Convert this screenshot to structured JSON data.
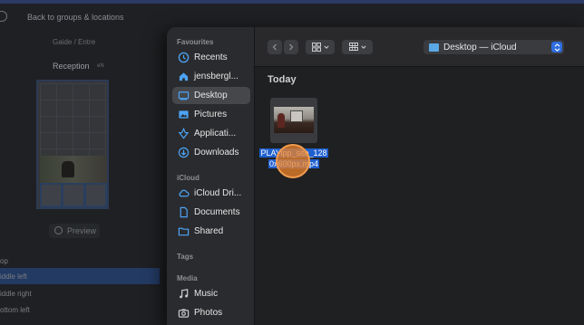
{
  "background_app": {
    "back_link": "Back to groups & locations",
    "tabs_text": "Gaide / Entre",
    "section_title": "Reception",
    "section_badge": "eN",
    "preview_button": "Preview",
    "list_items": [
      "op",
      "iddle left",
      "iddle right",
      "ottom left"
    ]
  },
  "sidebar": {
    "favourites_heading": "Favourites",
    "favourites": [
      {
        "label": "Recents",
        "icon": "clock-icon"
      },
      {
        "label": "jensbergl...",
        "icon": "home-icon"
      },
      {
        "label": "Desktop",
        "icon": "desktop-icon",
        "selected": true
      },
      {
        "label": "Pictures",
        "icon": "photo-icon"
      },
      {
        "label": "Applicati...",
        "icon": "applications-icon"
      },
      {
        "label": "Downloads",
        "icon": "download-icon"
      }
    ],
    "icloud_heading": "iCloud",
    "icloud": [
      {
        "label": "iCloud Dri...",
        "icon": "cloud-icon"
      },
      {
        "label": "Documents",
        "icon": "document-icon"
      },
      {
        "label": "Shared",
        "icon": "shared-folder-icon"
      }
    ],
    "tags_heading": "Tags",
    "media_heading": "Media",
    "media": [
      {
        "label": "Music",
        "icon": "music-note-icon"
      },
      {
        "label": "Photos",
        "icon": "camera-icon"
      }
    ]
  },
  "toolbar": {
    "location_label": "Desktop — iCloud"
  },
  "content": {
    "group_header": "Today",
    "file": {
      "name_line1": "PLAYipp_site_128",
      "name_line2": "0x600px.mp4"
    }
  },
  "colors": {
    "accent": "#2f6de0",
    "selection_label": "#1f5fcf",
    "cursor_highlight": "#e8802a",
    "sidebar_selected": "#45474b"
  }
}
